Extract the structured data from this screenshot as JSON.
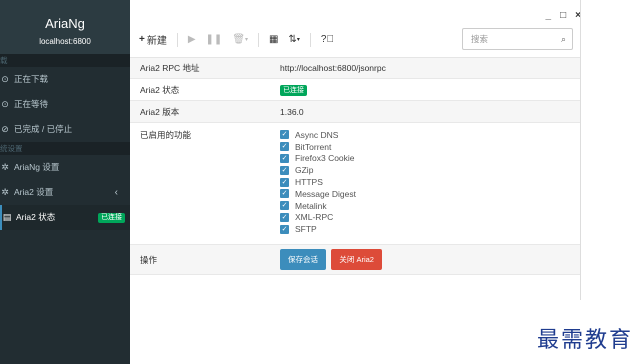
{
  "sidebar": {
    "title": "AriaNg",
    "subtitle": "localhost:6800",
    "download_header": "载",
    "items": [
      {
        "label": "正在下载",
        "icon": "play-circle-icon"
      },
      {
        "label": "正在等待",
        "icon": "pause-circle-icon"
      },
      {
        "label": "已完成 / 已停止",
        "icon": "check-circle-icon"
      }
    ],
    "settings_header": "统设置",
    "settings": [
      {
        "label": "AriaNg 设置",
        "icon": "gear-icon"
      },
      {
        "label": "Aria2 设置",
        "icon": "gears-icon"
      },
      {
        "label": "Aria2 状态",
        "icon": "server-icon",
        "badge": "已连接"
      }
    ]
  },
  "window": {
    "minimize": "_",
    "maximize": "□",
    "close": "×"
  },
  "toolbar": {
    "new_label": "新建",
    "search_placeholder": "搜索"
  },
  "status": {
    "rpc_key": "Aria2 RPC 地址",
    "rpc_value": "http://localhost:6800/jsonrpc",
    "state_key": "Aria2 状态",
    "state_value": "已连接",
    "version_key": "Aria2 版本",
    "version_value": "1.36.0",
    "features_key": "已启用的功能",
    "features": [
      "Async DNS",
      "BitTorrent",
      "Firefox3 Cookie",
      "GZip",
      "HTTPS",
      "Message Digest",
      "Metalink",
      "XML-RPC",
      "SFTP"
    ],
    "ops_key": "操作",
    "save_session": "保存会话",
    "shutdown": "关闭 Aria2"
  },
  "watermark": "最需教育",
  "colors": {
    "sidebar_bg": "#222d32",
    "accent": "#3c8dbc",
    "success": "#00a65a",
    "danger": "#dd4b39"
  }
}
